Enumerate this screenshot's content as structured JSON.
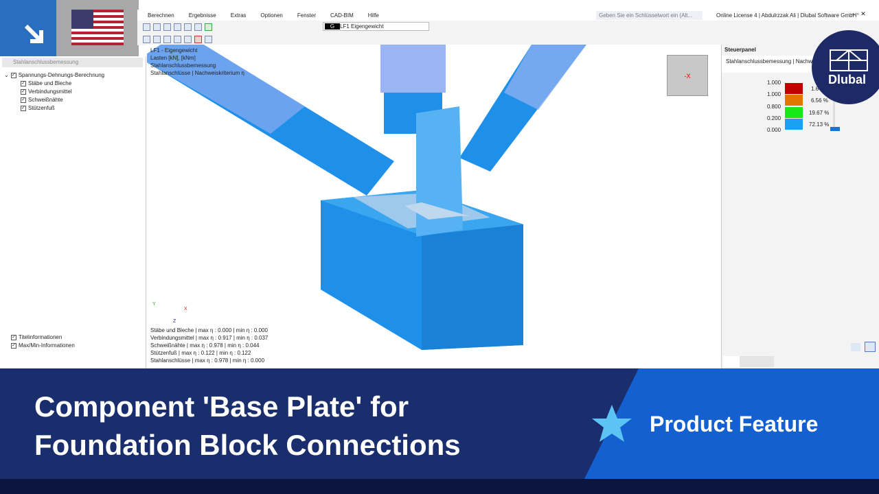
{
  "menu": [
    "Berechnen",
    "Ergebnisse",
    "Extras",
    "Optionen",
    "Fenster",
    "CAD-BIM",
    "Hilfe"
  ],
  "search_placeholder": "Geben Sie ein Schlüsselwort ein (Alt...",
  "license": "Online License 4 | Abdulrzzak Ali | Dlubal Software GmbH",
  "loadcase": {
    "badge": "G",
    "id": "LF1",
    "name": "Eigengewicht"
  },
  "navigator": {
    "title": "Stahlanschlussbemessung",
    "root": "Spannungs-Dehnungs-Berechnung",
    "items": [
      "Stäbe und Bleche",
      "Verbindungsmittel",
      "Schweißnähte",
      "Stützenfuß"
    ],
    "bottom": [
      "Titelinformationen",
      "Max/Min-Informationen"
    ]
  },
  "viewport": {
    "header": [
      "LF1 - Eigengewicht",
      "Lasten [kN], [kNm]",
      "Stahlanschlussbemessung",
      "Stahlanschlüsse | Nachweiskriterium η"
    ],
    "summary": [
      "Stäbe und Bleche | max η : 0.000 | min η : 0.000",
      "Verbindungsmittel | max η : 0.917 | min η : 0.037",
      "Schweißnähte | max η : 0.978 | min η : 0.044",
      "Stützenfuß | max η : 0.122 | min η : 0.122",
      "Stahlanschlüsse | max η : 0.978 | min η : 0.000"
    ],
    "axes": {
      "x": "X",
      "y": "Y",
      "z": "Z"
    },
    "cube_label": "-X"
  },
  "panel": {
    "title": "Steuerpanel",
    "subtitle": "Stahlanschlussbemessung | Nachweis",
    "legend": [
      {
        "value": "1.000",
        "pct": "1.64 %",
        "color": "#c00000"
      },
      {
        "value": "1.000",
        "pct": "6.56 %",
        "color": "#e07800"
      },
      {
        "value": "0.800",
        "pct": "19.67 %",
        "color": "#18e818"
      },
      {
        "value": "0.200",
        "pct": "72.13 %",
        "color": "#1aa0f0"
      }
    ],
    "legend_min": "0.000"
  },
  "banner": {
    "line1": "Component 'Base Plate' for",
    "line2": "Foundation Block Connections",
    "tag": "Product Feature",
    "logo": "Dlubal"
  }
}
